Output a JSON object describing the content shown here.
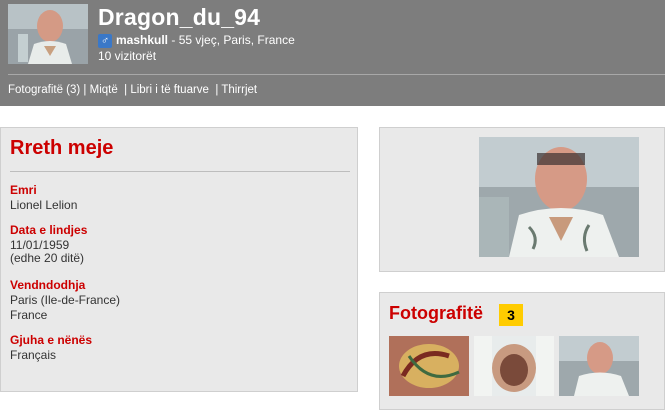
{
  "profile": {
    "username": "Dragon_du_94",
    "gender": "mashkull",
    "age_location": " - 55 vjeç, Paris, France",
    "visitors": "10 vizitorët"
  },
  "nav": {
    "photos": "Fotografitë (3)",
    "friends": "Miqtë",
    "guestbook": "Libri i të ftuarve",
    "calls": "Thirrjet"
  },
  "about": {
    "title": "Rreth meje",
    "name_label": "Emri",
    "name_value": "Lionel Lelion",
    "birth_label": "Data e lindjes",
    "birth_value": "11/01/1959",
    "birth_note": "(edhe 20 ditë)",
    "location_label": "Vendndodhja",
    "location_value": "Paris (Ile-de-France)",
    "location_country": "France",
    "language_label": "Gjuha e nënës",
    "language_value": "Français"
  },
  "gallery": {
    "title": "Fotografitë",
    "count": "3"
  },
  "icons": {
    "gender": "male-symbol-icon"
  },
  "colors": {
    "accent": "#cc0000",
    "header_bg": "#7d7d7d",
    "badge": "#ffcc00"
  }
}
